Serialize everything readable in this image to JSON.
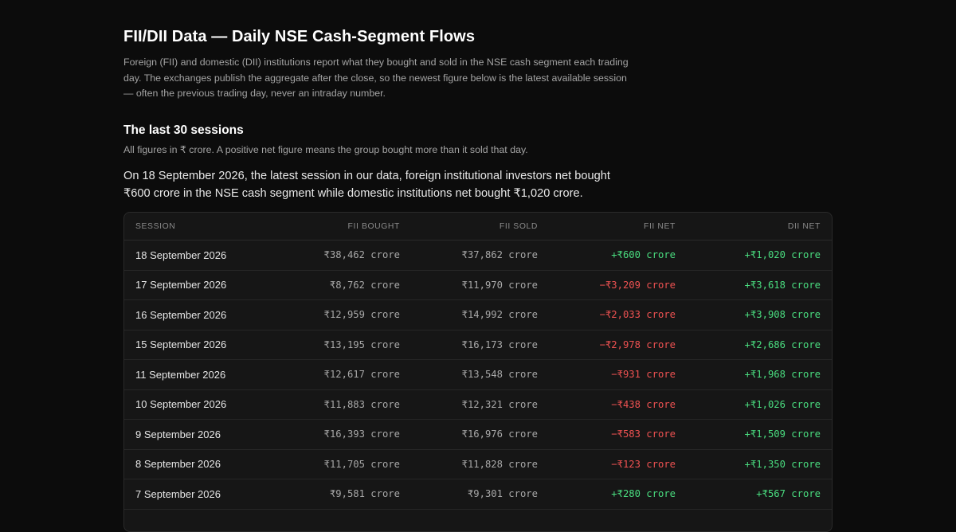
{
  "page": {
    "title": "FII/DII Data — Daily NSE Cash-Segment Flows",
    "intro": "Foreign (FII) and domestic (DII) institutions report what they bought and sold in the NSE cash segment each trading day. The exchanges publish the aggregate after the close, so the newest figure below is the latest available session — often the previous trading day, never an intraday number.",
    "section_title": "The last 30 sessions",
    "note": "All figures in ₹ crore. A positive net figure means the group bought more than it sold that day.",
    "summary": "On 18 September 2026, the latest session in our data, foreign institutional investors net bought ₹600 crore in the NSE cash segment while domestic institutions net bought ₹1,020 crore."
  },
  "table": {
    "headers": [
      "SESSION",
      "FII BOUGHT",
      "FII SOLD",
      "FII NET",
      "DII NET"
    ],
    "rows": [
      {
        "session": "18 September 2026",
        "fii_bought": "₹38,462 crore",
        "fii_sold": "₹37,862 crore",
        "fii_net": "+₹600 crore",
        "dii_net": "+₹1,020 crore"
      },
      {
        "session": "17 September 2026",
        "fii_bought": "₹8,762 crore",
        "fii_sold": "₹11,970 crore",
        "fii_net": "−₹3,209 crore",
        "dii_net": "+₹3,618 crore"
      },
      {
        "session": "16 September 2026",
        "fii_bought": "₹12,959 crore",
        "fii_sold": "₹14,992 crore",
        "fii_net": "−₹2,033 crore",
        "dii_net": "+₹3,908 crore"
      },
      {
        "session": "15 September 2026",
        "fii_bought": "₹13,195 crore",
        "fii_sold": "₹16,173 crore",
        "fii_net": "−₹2,978 crore",
        "dii_net": "+₹2,686 crore"
      },
      {
        "session": "11 September 2026",
        "fii_bought": "₹12,617 crore",
        "fii_sold": "₹13,548 crore",
        "fii_net": "−₹931 crore",
        "dii_net": "+₹1,968 crore"
      },
      {
        "session": "10 September 2026",
        "fii_bought": "₹11,883 crore",
        "fii_sold": "₹12,321 crore",
        "fii_net": "−₹438 crore",
        "dii_net": "+₹1,026 crore"
      },
      {
        "session": "9 September 2026",
        "fii_bought": "₹16,393 crore",
        "fii_sold": "₹16,976 crore",
        "fii_net": "−₹583 crore",
        "dii_net": "+₹1,509 crore"
      },
      {
        "session": "8 September 2026",
        "fii_bought": "₹11,705 crore",
        "fii_sold": "₹11,828 crore",
        "fii_net": "−₹123 crore",
        "dii_net": "+₹1,350 crore"
      },
      {
        "session": "7 September 2026",
        "fii_bought": "₹9,581 crore",
        "fii_sold": "₹9,301 crore",
        "fii_net": "+₹280 crore",
        "dii_net": "+₹567 crore"
      }
    ]
  },
  "colors": {
    "positive": "#4ade80",
    "negative": "#f05252",
    "background": "#0c0c0c"
  }
}
